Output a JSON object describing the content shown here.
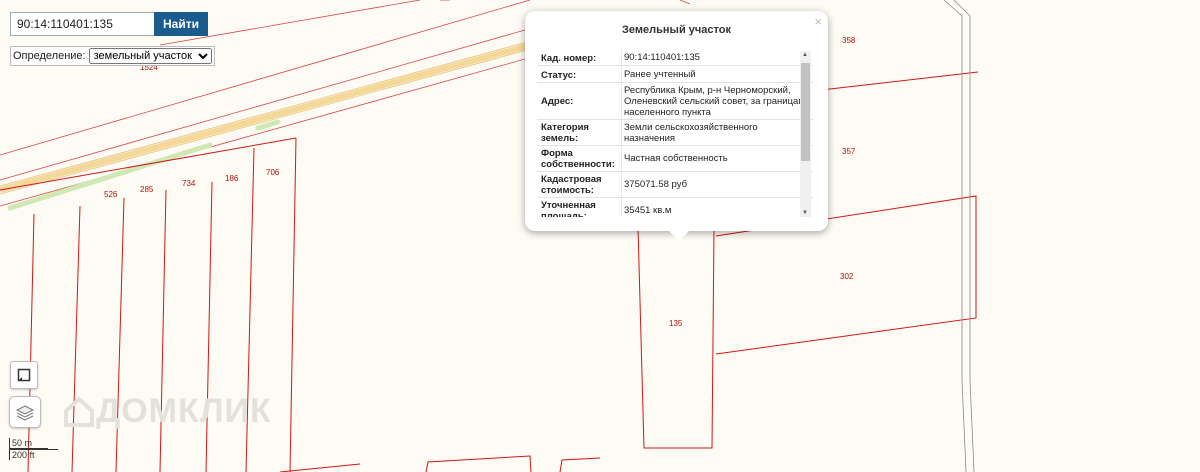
{
  "search": {
    "value": "90:14:110401:135",
    "button_label": "Найти"
  },
  "definition": {
    "label": "Определение:",
    "selected": "земельный участок"
  },
  "map": {
    "parcels": [
      {
        "label": "1524"
      },
      {
        "label": "526"
      },
      {
        "label": "285"
      },
      {
        "label": "734"
      },
      {
        "label": "186"
      },
      {
        "label": "706"
      },
      {
        "label": "358"
      },
      {
        "label": "357"
      },
      {
        "label": "302"
      },
      {
        "label": "135"
      }
    ],
    "watermark": "ДОМКЛИК",
    "scale_metric": "50 m",
    "scale_imperial": "200 ft",
    "colors": {
      "parcel_line": "#d01818",
      "road": "#f3d89a",
      "green": "#cfe9b4",
      "background": "#fdfbf4"
    }
  },
  "popup": {
    "title": "Земельный участок",
    "close_label": "×",
    "rows": [
      {
        "key": "Кад. номер:",
        "value": "90:14:110401:135"
      },
      {
        "key": "Статус:",
        "value": "Ранее учтенный"
      },
      {
        "key": "Адрес:",
        "value": "Республика Крым, р-н Черноморский, Оленевский сельский совет, за границами населенного пункта"
      },
      {
        "key": "Категория земель:",
        "value": "Земли сельскохозяйственного назначения"
      },
      {
        "key": "Форма собственности:",
        "value": "Частная собственность"
      },
      {
        "key": "Кадастровая стоимость:",
        "value": "375071.58 руб"
      },
      {
        "key": "Уточненная площадь:",
        "value": "35451 кв.м"
      }
    ]
  },
  "controls": {
    "fullscreen_icon": "fullscreen-icon",
    "layers_icon": "layers-icon"
  }
}
